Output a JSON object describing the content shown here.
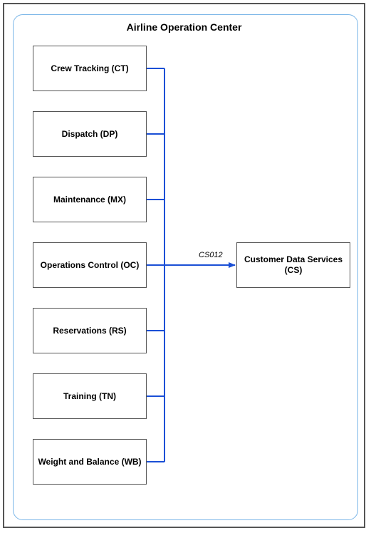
{
  "container": {
    "title": "Airline Operation Center"
  },
  "nodes": {
    "ct": "Crew Tracking (CT)",
    "dp": "Dispatch (DP)",
    "mx": "Maintenance (MX)",
    "oc": "Operations Control (OC)",
    "rs": "Reservations (RS)",
    "tn": "Training (TN)",
    "wb": "Weight and Balance (WB)",
    "cs": "Customer Data Services (CS)"
  },
  "edge": {
    "label": "CS012"
  }
}
